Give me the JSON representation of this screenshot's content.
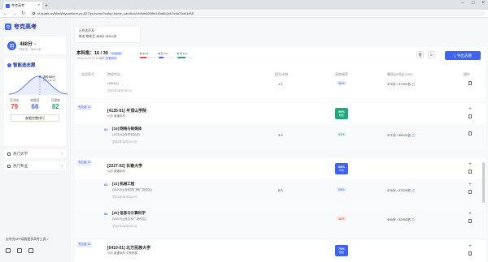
{
  "browser": {
    "tab_title": "夸克高考",
    "url": "vt.quark.cn/blm/shiyuanform-pc-827/pc-home?entry=home_card&uid=b9db405f9e140e6b2eb7e9a75dd1d55"
  },
  "brand": {
    "name": "夸克高考",
    "logo": "夸"
  },
  "user": {
    "avatar": "用",
    "score": "488分",
    "edit": "✎",
    "sub": "物化生 · 34511名"
  },
  "smart": {
    "title": "智能选志愿",
    "my_score": "我的488分",
    "my_rank": "排名34511名",
    "labels": {
      "chong": "可冲击",
      "wen": "较稳妥",
      "bao": "可保底"
    },
    "values": {
      "chong": "79",
      "wen": "66",
      "bao": "82"
    },
    "view_btn": "查看完整排行"
  },
  "menu": [
    {
      "label": "热门大学"
    },
    {
      "label": "热门专业"
    }
  ],
  "bottom_hint": "去夸克APP填报更多高考工具 >",
  "plan": {
    "line1": "示例志愿表",
    "line2": "姓名 物化生 488分 34511名"
  },
  "header": {
    "title": "本科批：16 / 30",
    "tag": "可冲稳保",
    "sub_time": "2024-06-25 15:20编辑",
    "sub_link": "查看规则",
    "bars": [
      {
        "label": "冲 18",
        "color": "#e8473b",
        "pct": 40
      },
      {
        "label": "稳 6%",
        "color": "#3d63f5",
        "pct": 30
      },
      {
        "label": "保 11%",
        "color": "#20a87a",
        "pct": 50
      }
    ],
    "btn": "导出志愿",
    "icons": [
      "trash-icon",
      "refresh-icon"
    ]
  },
  "columns": {
    "c1": "志愿序号",
    "c2": "院校专业",
    "c3": "招生计划",
    "c4": "录取概率",
    "c5": "最低分/排名 2023",
    "c6": "操作"
  },
  "rows": {
    "r0": {
      "count": "1人",
      "pill": "68%",
      "score": "475分 / 37291名",
      "meta": "(4600元)",
      "meta2": "学制4年/每年4600元"
    },
    "r1": {
      "group": "专业组 14",
      "code": "[4135-01] 平顶山学院",
      "tags": "公办 普通本科",
      "badge_pct": "90%",
      "badge_txt": "较稳",
      "sub_num": "01",
      "sub_name": "[10] 网络与新媒体",
      "sub_desc": "(4400元)(含学校地点)",
      "sub_meta": "学制4年/每年4400元",
      "count": "3人",
      "pill": "90%",
      "score": "471分 / 38122名"
    },
    "r2": {
      "group": "专业组 15",
      "code": "[2227-02] 长春大学",
      "tags": "公办 普通本科",
      "badge_pct": "68%",
      "badge_txt": "可冲",
      "s1_num": "01",
      "s1_name": "[21] 机械工程",
      "s1_desc": "(5540元)(含校园门牌广场校区)",
      "s1_meta": "学制4年/每年5540元",
      "s1_count": "2人",
      "s1_pill": "68%",
      "s1_score": "476分 / 37109名",
      "s2_num": "02",
      "s2_name": "[20] 信息与计算科学",
      "s2_desc": "(5500元)(含吉林广场校区)",
      "s2_meta": "学制4年/每年5500元",
      "s2_pill": "58%",
      "s2_score": "495分 / 32953名"
    },
    "r3": {
      "group": "专业组 16",
      "code": "[6410-01] 北方民族大学",
      "tags": "公办 普通本科 中央部属",
      "badge_pct": "79%",
      "badge_txt": "较稳"
    }
  }
}
